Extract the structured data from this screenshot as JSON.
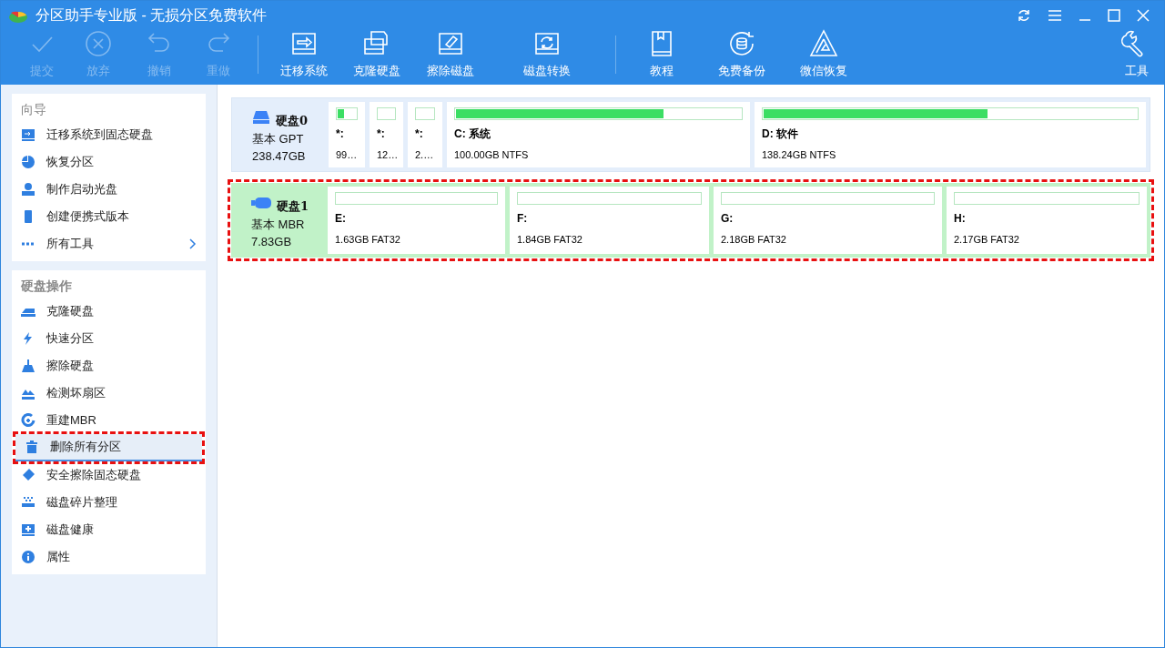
{
  "window": {
    "title": "分区助手专业版 - 无损分区免费软件"
  },
  "toolbar": [
    {
      "label": "提交",
      "disabled": true
    },
    {
      "label": "放弃",
      "disabled": true
    },
    {
      "label": "撤销",
      "disabled": true
    },
    {
      "label": "重做",
      "disabled": true
    },
    {
      "label": "迁移系统",
      "disabled": false
    },
    {
      "label": "克隆硬盘",
      "disabled": false
    },
    {
      "label": "擦除磁盘",
      "disabled": false
    },
    {
      "label": "磁盘转换",
      "disabled": false
    },
    {
      "label": "教程",
      "disabled": false
    },
    {
      "label": "免费备份",
      "disabled": false
    },
    {
      "label": "微信恢复",
      "disabled": false
    },
    {
      "label": "工具",
      "disabled": false
    }
  ],
  "sidebar": [
    {
      "title": "向导",
      "items": [
        {
          "label": "迁移系统到固态硬盘",
          "selected": false,
          "submenu": false,
          "highlighted": false
        },
        {
          "label": "恢复分区",
          "selected": false,
          "submenu": false,
          "highlighted": false
        },
        {
          "label": "制作启动光盘",
          "selected": false,
          "submenu": false,
          "highlighted": false
        },
        {
          "label": "创建便携式版本",
          "selected": false,
          "submenu": false,
          "highlighted": false
        },
        {
          "label": "所有工具",
          "selected": false,
          "submenu": true,
          "highlighted": false
        }
      ]
    },
    {
      "title": "硬盘操作",
      "items": [
        {
          "label": "克隆硬盘",
          "selected": false,
          "submenu": false,
          "highlighted": false
        },
        {
          "label": "快速分区",
          "selected": false,
          "submenu": false,
          "highlighted": false
        },
        {
          "label": "擦除硬盘",
          "selected": false,
          "submenu": false,
          "highlighted": false
        },
        {
          "label": "检测坏扇区",
          "selected": false,
          "submenu": false,
          "highlighted": false
        },
        {
          "label": "重建MBR",
          "selected": false,
          "submenu": false,
          "highlighted": false
        },
        {
          "label": "删除所有分区",
          "selected": true,
          "submenu": false,
          "highlighted": true
        },
        {
          "label": "安全擦除固态硬盘",
          "selected": false,
          "submenu": false,
          "highlighted": false
        },
        {
          "label": "磁盘碎片整理",
          "selected": false,
          "submenu": false,
          "highlighted": false
        },
        {
          "label": "磁盘健康",
          "selected": false,
          "submenu": false,
          "highlighted": false
        },
        {
          "label": "属性",
          "selected": false,
          "submenu": false,
          "highlighted": false
        }
      ]
    }
  ],
  "disks": [
    {
      "name": "硬盘0",
      "type": "基本 GPT",
      "size": "238.47GB",
      "kind": "ssd",
      "selected": false,
      "highlighted": false,
      "partitions": [
        {
          "letter": "*:",
          "info": "99…",
          "level": 0.35
        },
        {
          "letter": "*:",
          "info": "12…",
          "level": 0
        },
        {
          "letter": "*:",
          "info": "2.…",
          "level": 0
        },
        {
          "letter": "C: 系统",
          "info": "100.00GB NTFS",
          "level": 0.73
        },
        {
          "letter": "D: 软件",
          "info": "138.24GB NTFS",
          "level": 0.6
        }
      ]
    },
    {
      "name": "硬盘1",
      "type": "基本 MBR",
      "size": "7.83GB",
      "kind": "usb",
      "selected": true,
      "highlighted": true,
      "partitions": [
        {
          "letter": "E:",
          "info": "1.63GB FAT32",
          "level": 0
        },
        {
          "letter": "F:",
          "info": "1.84GB FAT32",
          "level": 0
        },
        {
          "letter": "G:",
          "info": "2.18GB FAT32",
          "level": 0
        },
        {
          "letter": "H:",
          "info": "2.17GB FAT32",
          "level": 0
        }
      ]
    }
  ]
}
